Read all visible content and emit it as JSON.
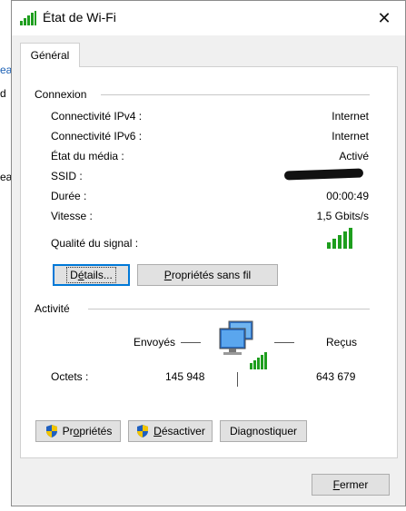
{
  "background_fragments": [
    "ea",
    "d",
    "ea"
  ],
  "window": {
    "title": "État de Wi-Fi",
    "close_glyph": "✕"
  },
  "tabs": [
    {
      "label": "Général",
      "selected": true
    }
  ],
  "connexion": {
    "title": "Connexion",
    "rows": [
      {
        "label": "Connectivité IPv4 :",
        "value": "Internet"
      },
      {
        "label": "Connectivité IPv6 :",
        "value": "Internet"
      },
      {
        "label": "État du média :",
        "value": "Activé"
      },
      {
        "label": "SSID :",
        "value": ""
      },
      {
        "label": "Durée :",
        "value": "00:00:49"
      },
      {
        "label": "Vitesse :",
        "value": "1,5 Gbits/s"
      }
    ],
    "signal_label": "Qualité du signal :",
    "signal_bars_filled": 5,
    "signal_bars_total": 5,
    "details_button": {
      "pre": "D",
      "underlined": "é",
      "post": "tails..."
    },
    "wireless_props_button": {
      "pre": "",
      "underlined": "P",
      "post": "ropriétés sans fil"
    }
  },
  "activite": {
    "title": "Activité",
    "sent_label": "Envoyés",
    "received_label": "Reçus",
    "bytes_label": "Octets :",
    "bytes_sent": "145 948",
    "bytes_received": "643 679",
    "properties_button": {
      "pre": "Pr",
      "underlined": "o",
      "post": "priétés"
    },
    "disable_button": {
      "pre": "",
      "underlined": "D",
      "post": "ésactiver"
    },
    "diagnose_button": {
      "pre": "Dia",
      "underlined": "g",
      "post": "nostiquer"
    }
  },
  "footer": {
    "close_button": {
      "pre": "",
      "underlined": "F",
      "post": "ermer"
    }
  },
  "colors": {
    "accent": "#0078d7",
    "signal_green": "#1e9e1e",
    "button_bg": "#e1e1e1"
  }
}
